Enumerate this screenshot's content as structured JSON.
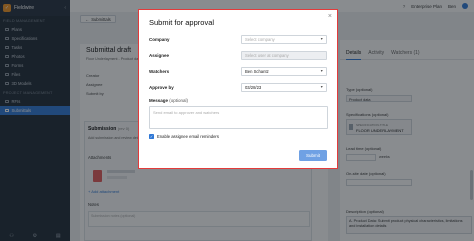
{
  "sidebar": {
    "org": "Fieldwire",
    "section_field": "FIELD MANAGEMENT",
    "items": [
      {
        "label": "Plans"
      },
      {
        "label": "Specifications"
      },
      {
        "label": "Tasks"
      },
      {
        "label": "Photos"
      },
      {
        "label": "Forms"
      },
      {
        "label": "Files"
      },
      {
        "label": "3D Models"
      }
    ],
    "section_project": "PROJECT MANAGEMENT",
    "items2": [
      {
        "label": "RFIs"
      },
      {
        "label": "Submittals"
      }
    ]
  },
  "topbar": {
    "plan": "Enterprise Plan",
    "user": "Ben"
  },
  "header": {
    "back_label": "Submittals"
  },
  "main": {
    "title": "Submittal draft",
    "subtitle": "Floor Underlayment - Product data",
    "creator_label": "Creator",
    "assignee_label": "Assignee",
    "submitby_label": "Submit by",
    "submission": {
      "header": "Submission",
      "count": "(rev 0)",
      "text": "Add submission and review details",
      "attachments_label": "Attachments",
      "add_attachment": "+ Add attachment",
      "notes_label": "Notes",
      "notes_placeholder": "Submission notes (optional)"
    }
  },
  "details": {
    "tabs": [
      "Details",
      "Activity",
      "Watchers (1)"
    ],
    "type_label": "Type (optional)",
    "type_value": "Product data",
    "spec_label": "Specifications (optional)",
    "spec_code": "SPECIFICATION-TITLE",
    "spec_title": "FLOOR UNDERLAYMENT",
    "lead_label": "Lead time (optional)",
    "lead_unit": "weeks",
    "onsite_label": "On-site date (optional)",
    "desc_label": "Description (optional)",
    "desc_value": "A. Product Data: Submit product physical characteristics, limitations and installation details"
  },
  "modal": {
    "title": "Submit for approval",
    "close": "×",
    "company_label": "Company",
    "company_placeholder": "Select company",
    "assignee_label": "Assignee",
    "assignee_placeholder": "Select user at company",
    "watchers_label": "Watchers",
    "watchers_value": "Ben Schantz",
    "approve_label": "Approve by",
    "approve_value": "03/28/23",
    "message_label": "Message",
    "message_optional": "(optional)",
    "message_placeholder": "Send email to approver and watchers",
    "checkbox_label": "Enable assignee email reminders",
    "submit_label": "Submit"
  }
}
